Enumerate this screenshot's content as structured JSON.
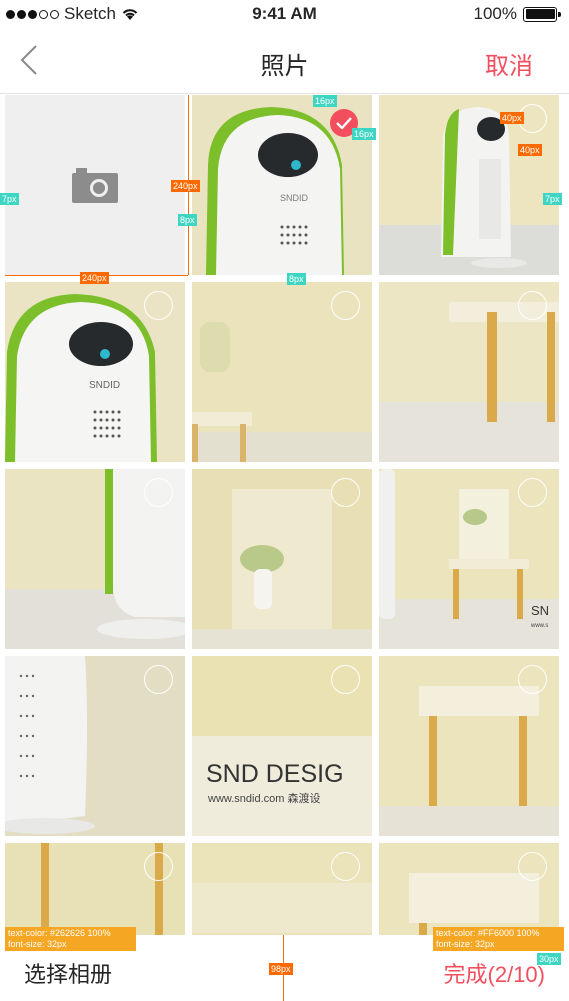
{
  "status_bar": {
    "carrier": "Sketch",
    "time": "9:41 AM",
    "battery": "100%"
  },
  "nav": {
    "title": "照片",
    "cancel_label": "取消"
  },
  "grid": {
    "cells": [
      {
        "type": "camera"
      },
      {
        "type": "photo",
        "scene": "purifier-front-green",
        "selected": true
      },
      {
        "type": "photo",
        "scene": "purifier-side",
        "selected": false
      },
      {
        "type": "photo",
        "scene": "purifier-closeup",
        "selected": false
      },
      {
        "type": "photo",
        "scene": "chair-blur",
        "selected": false
      },
      {
        "type": "photo",
        "scene": "chair-leg",
        "selected": false
      },
      {
        "type": "photo",
        "scene": "purifier-base",
        "selected": false
      },
      {
        "type": "photo",
        "scene": "vase-blur",
        "selected": false
      },
      {
        "type": "photo",
        "scene": "chair-vase",
        "selected": false
      },
      {
        "type": "photo",
        "scene": "grille-closeup",
        "selected": false
      },
      {
        "type": "photo",
        "scene": "logo-text",
        "selected": false
      },
      {
        "type": "photo",
        "scene": "chair-legs-blur",
        "selected": false
      },
      {
        "type": "photo",
        "scene": "chair-partial",
        "selected": false
      },
      {
        "type": "photo",
        "scene": "wall-blur",
        "selected": false
      },
      {
        "type": "photo",
        "scene": "stool-blur",
        "selected": false
      }
    ],
    "photo_texts": {
      "brand_small": "SNDID",
      "design_big": "SND DESIG",
      "design_url": "www.sndid.com 森渡设",
      "snd_edge": "SN",
      "www_edge": "www.s"
    }
  },
  "bottom_bar": {
    "album_label": "选择相册",
    "done_label": "完成(2/10)"
  },
  "annotations": {
    "gap_16": "16px",
    "gap_16b": "16px",
    "size_40a": "40px",
    "size_40b": "40px",
    "size_240h": "240px",
    "size_240w": "240px",
    "gap_8a": "8px",
    "gap_8b": "8px",
    "gap_7a": "7px",
    "gap_7b": "7px",
    "height_98": "98px",
    "margin_30": "30px",
    "spec_left": "text-color: #262626 100%\nfont-size: 32px",
    "spec_right": "text-color: #FF6000 100%\nfont-size: 32px"
  },
  "colors": {
    "accent": "#f24e5e",
    "text": "#262626",
    "spec_orange": "#ff6a00",
    "spec_teal": "#3ed6c2"
  }
}
